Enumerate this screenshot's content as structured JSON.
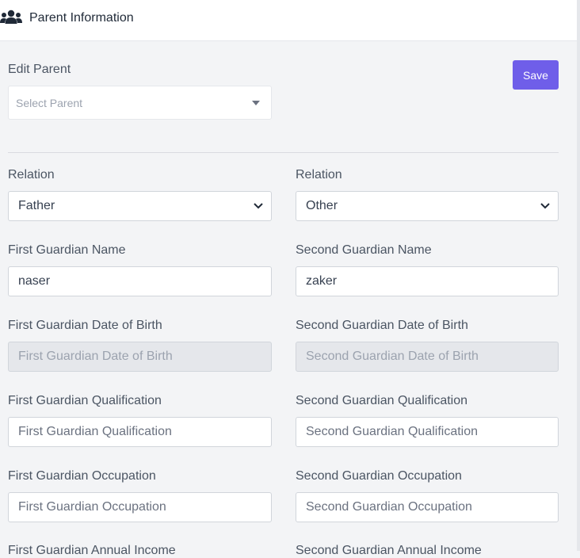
{
  "header": {
    "title": "Parent Information",
    "icon": "users-icon"
  },
  "edit_parent": {
    "label": "Edit Parent",
    "placeholder": "Select Parent"
  },
  "save_label": "Save",
  "colors": {
    "accent": "#6f5ee9"
  },
  "form": {
    "relation_left": {
      "label": "Relation",
      "value": "Father"
    },
    "relation_right": {
      "label": "Relation",
      "value": "Other"
    },
    "first_name": {
      "label": "First Guardian Name",
      "value": "naser"
    },
    "second_name": {
      "label": "Second Guardian Name",
      "value": "zaker"
    },
    "first_dob": {
      "label": "First Guardian Date of Birth",
      "placeholder": "First Guardian Date of Birth"
    },
    "second_dob": {
      "label": "Second Guardian Date of Birth",
      "placeholder": "Second Guardian Date of Birth"
    },
    "first_qual": {
      "label": "First Guardian Qualification",
      "placeholder": "First Guardian Qualification"
    },
    "second_qual": {
      "label": "Second Guardian Qualification",
      "placeholder": "Second Guardian Qualification"
    },
    "first_occ": {
      "label": "First Guardian Occupation",
      "placeholder": "First Guardian Occupation"
    },
    "second_occ": {
      "label": "Second Guardian Occupation",
      "placeholder": "Second Guardian Occupation"
    },
    "first_income": {
      "label": "First Guardian Annual Income"
    },
    "second_income": {
      "label": "Second Guardian Annual Income"
    }
  }
}
